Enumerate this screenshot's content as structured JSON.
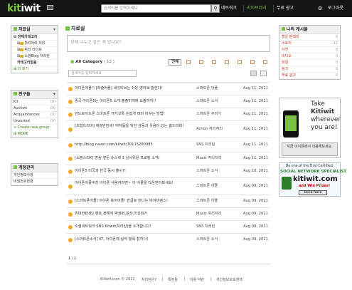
{
  "header": {
    "logo_text": "kitiwit",
    "search_placeholder": "검색어를 입력하세요",
    "search_icon": "magnifier-icon",
    "nav": {
      "network": "네트워크",
      "library": "라이브러리",
      "free_ad": "무료 광고",
      "logout": "로그아웃"
    },
    "accent": "#7cc242"
  },
  "left": {
    "materials": {
      "title": "자료실",
      "items": [
        {
          "label": "전체카테고리"
        },
        {
          "label": "처리처리 처리"
        },
        {
          "label": "처리 라이브"
        },
        {
          "label": "소셜Blog 처리탄"
        },
        {
          "label": "카테고리없음"
        }
      ],
      "more": "더 보기"
    },
    "friends": {
      "title": "친구들",
      "items": [
        {
          "label": "Kit",
          "count": "(0)"
        },
        {
          "label": "Auction",
          "count": "(0)"
        },
        {
          "label": "Acquaintances",
          "count": "(0)"
        },
        {
          "label": "Unsorted",
          "count": "(0)"
        }
      ],
      "create": "+ Create new group",
      "more": "MORE"
    },
    "account": {
      "title": "계정관리",
      "items": [
        {
          "label": "개인정보수정"
        },
        {
          "label": "비밀번호변경"
        }
      ]
    }
  },
  "main": {
    "title": "자료실",
    "memo_placeholder": "함께 나누고 싶은 게 있나요?",
    "category_label": "All Category",
    "category_count": "( 12 )",
    "filter_all": "전체",
    "filter_input_placeholder": "검색어를 입력하세요",
    "posts": [
      {
        "title": "아이폰어플!! [학습어플] 네이티브는 쉬운 영어로 말한다!",
        "source": "스마트폰 어플",
        "date": "Aug 11, 2011"
      },
      {
        "title": "중국 아이폰5는 아이폰5 소개 출출미게에 요출까지!!",
        "source": "스마트폰 소식",
        "date": "Aug 11, 2011"
      },
      {
        "title": "안드로이드폰 스마트폰 카카오톡 손쉽게 태마 바꾸는 방법!",
        "source": "스마트폰 꾸미기",
        "date": "Aug 11, 2011"
      },
      {
        "title": "[조합드라마] 애정만만세! 여자들을 위한 감동과 웃음이 있는 홈드라마!",
        "source": "Action 처리처리",
        "date": "Aug 11, 2011"
      },
      {
        "title": "http://blog.naver.com/kitwit/30115280985",
        "source": "SNS 처리탄",
        "date": "Aug 11, 2011"
      },
      {
        "title": "[쇼핑스타K] 방송 앞둔 슈스케 3 심사위원 프로필 소개!",
        "source": "Music 처리처리",
        "date": "Aug 11, 2011"
      },
      {
        "title": "아이폰5 미국과 한국 동시 출시?!",
        "source": "스마트폰 소식",
        "date": "Aug 10, 2011"
      },
      {
        "title": "아이폰어플추천 아이폰 사용자라면~ 이 어플을 다운받아보세요!",
        "source": "스마트폰 어플",
        "date": "Aug 09, 2011"
      },
      {
        "title": "[스마트폰어플] 아이폰 축어어플! 한글로 만나는 바이비영스!",
        "source": "스마트폰 어플",
        "date": "Aug 09, 2011"
      },
      {
        "title": "위대한탄생2 멘토 정해져 박정현,윤상,이선희?!",
        "source": "Music 처리처리",
        "date": "Aug 09, 2011"
      },
      {
        "title": "소셜네트워크 SNS Kitwit(처리탄)을 소개합니다!",
        "source": "SNS 처리탄",
        "date": "Aug 09, 2011"
      },
      {
        "title": "[스마트폰소식] KT, 아이폰에 실적 발목 잡히다!",
        "source": "스마트폰 소식",
        "date": "Aug 09, 2011"
      }
    ],
    "pager": "1 / 1"
  },
  "right": {
    "mine": {
      "title": "나의 게시물",
      "items": [
        {
          "label": "할은 판매미",
          "count": "0"
        },
        {
          "label": "스토리",
          "count": "12"
        },
        {
          "label": "사진",
          "count": "0"
        },
        {
          "label": "비디오",
          "count": "0"
        },
        {
          "label": "파일",
          "count": "0"
        },
        {
          "label": "링크",
          "count": "0"
        },
        {
          "label": "무료 광고",
          "count": "0"
        }
      ]
    },
    "ad": {
      "line1": "Take",
      "line2": "Kitiwit",
      "line3": "wherever",
      "line4": "you are!",
      "button": "지금 아이폰에서 이용해보세요."
    },
    "banner": {
      "line1": "Be one of the First Certified",
      "line2": "SOCIAL NETWORK SPECIALIST",
      "brand": "kitiwit.com",
      "line3": "and Win Prizes!",
      "click": "Click here"
    }
  },
  "footer": {
    "copyright": "Kitiwit.com © 2011",
    "links": [
      "처리탄은?",
      "특징들",
      "이용 약관",
      "개인정보보호정책"
    ]
  }
}
